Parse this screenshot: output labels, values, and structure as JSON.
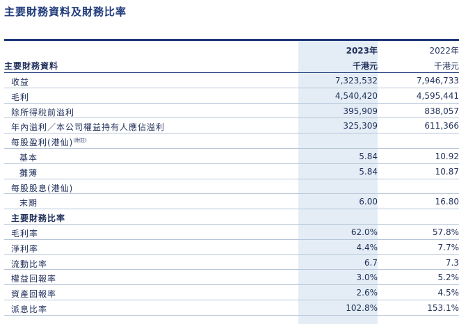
{
  "title": "主要財務資料及財務比率",
  "header": {
    "col_label": "主要財務資料",
    "year_2023": "2023年",
    "year_2022": "2022年",
    "unit_2023": "千港元",
    "unit_2022": "千港元"
  },
  "rows": [
    {
      "label": "收益",
      "v23": "7,323,532",
      "v22": "7,946,733",
      "kind": "normal"
    },
    {
      "label": "毛利",
      "v23": "4,540,420",
      "v22": "4,595,441",
      "kind": "normal"
    },
    {
      "label": "除所得稅前溢利",
      "v23": "395,909",
      "v22": "838,057",
      "kind": "normal"
    },
    {
      "label": "年內溢利／本公司權益持有人應佔溢利",
      "v23": "325,309",
      "v22": "611,366",
      "kind": "normal"
    },
    {
      "label": "每股盈利(港仙)",
      "note": "(附註)",
      "v23": "",
      "v22": "",
      "kind": "normal"
    },
    {
      "label": "基本",
      "v23": "5.84",
      "v22": "10.92",
      "kind": "indent"
    },
    {
      "label": "攤薄",
      "v23": "5.84",
      "v22": "10.87",
      "kind": "indent"
    },
    {
      "label": "每股股息(港仙)",
      "v23": "",
      "v22": "",
      "kind": "normal"
    },
    {
      "label": "末期",
      "v23": "6.00",
      "v22": "16.80",
      "kind": "indent"
    },
    {
      "label": "主要財務比率",
      "v23": "",
      "v22": "",
      "kind": "section"
    },
    {
      "label": "毛利率",
      "v23": "62.0%",
      "v22": "57.8%",
      "kind": "normal"
    },
    {
      "label": "淨利率",
      "v23": "4.4%",
      "v22": "7.7%",
      "kind": "normal"
    },
    {
      "label": "流動比率",
      "v23": "6.7",
      "v22": "7.3",
      "kind": "normal"
    },
    {
      "label": "權益回報率",
      "v23": "3.0%",
      "v22": "5.2%",
      "kind": "normal"
    },
    {
      "label": "資產回報率",
      "v23": "2.6%",
      "v22": "4.5%",
      "kind": "normal"
    },
    {
      "label": "派息比率",
      "v23": "102.8%",
      "v22": "153.1%",
      "kind": "normal"
    }
  ]
}
